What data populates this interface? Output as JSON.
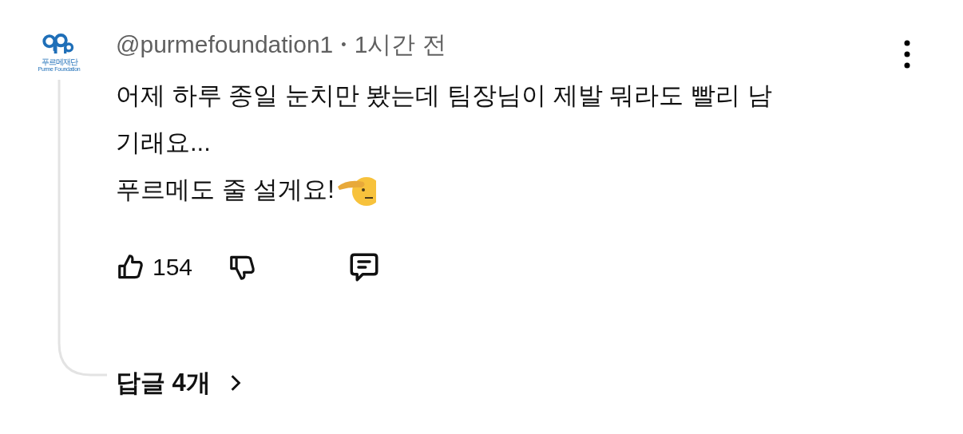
{
  "logo": {
    "name": "푸르메재단",
    "subtitle": "Purme Foundation"
  },
  "comment": {
    "author": "@purmefoundation1",
    "separator": "•",
    "time": "1시간 전",
    "lines": [
      "어제 하루 종일 눈치만 봤는데 팀장님이 제발 뭐라도 빨리 남",
      "기래요...",
      "푸르메도 줄 설게요!"
    ],
    "likes": "154",
    "liked": false,
    "disliked": false
  },
  "replies": {
    "label": "답글 4개"
  }
}
